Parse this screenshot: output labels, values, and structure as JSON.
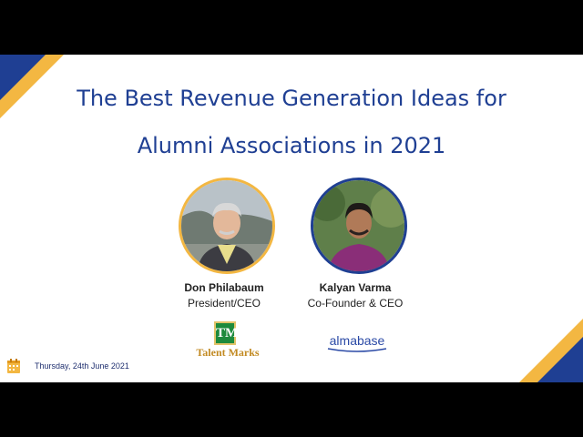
{
  "title": {
    "line1": "The Best Revenue Generation Ideas for",
    "line2": "Alumni Associations in 2021"
  },
  "speakers": [
    {
      "name": "Don Philabaum",
      "role": "President/CEO",
      "ring_color": "#f3b742"
    },
    {
      "name": "Kalyan Varma",
      "role": "Co-Founder & CEO",
      "ring_color": "#1f3f93"
    }
  ],
  "logos": {
    "talentmarks": {
      "monogram": "TM",
      "text": "Talent Marks"
    },
    "almabase": {
      "text": "almabase"
    }
  },
  "date": {
    "text": "Thursday, 24th June 2021",
    "icon": "calendar-icon"
  },
  "colors": {
    "navy": "#1f3f93",
    "gold": "#f3b742",
    "green": "#1d8a3c"
  }
}
